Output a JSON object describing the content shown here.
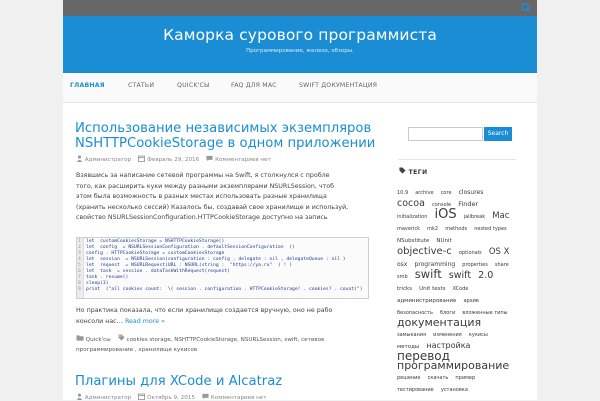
{
  "site": {
    "title": "Каморка сурового программиста",
    "description": "Программирование, железо, обзоры."
  },
  "nav": {
    "items": [
      {
        "label": "ГЛАВНАЯ",
        "active": true
      },
      {
        "label": "СТАТЬИ"
      },
      {
        "label": "QUICK'СЫ"
      },
      {
        "label": "FAQ ДЛЯ MAC"
      },
      {
        "label": "SWIFT ДОКУМЕНТАЦИЯ"
      }
    ]
  },
  "post1": {
    "title_line1": "Использование независимых экземпляров",
    "title_line2": "NSHTTPCookieStorage в одном приложении",
    "author": "Администратор",
    "date": "Февраль 29, 2016",
    "comments": "Комментариев нет",
    "excerpt": [
      "Взявшись за написание сетевой программы на Swift, я столкнулся с пробле",
      "того, как расширить куки между разными экземплярами NSURLSession, чтоб",
      "этом была возможность в разных местах использовать разные хранилища",
      "(хранить несколько сессий) Казалось бы, создавай свое хранилище и используй,",
      "свойство NSURLSessionConfiguration.HTTPCookieStorage доступно на запись"
    ],
    "code": [
      "let  customCookiesStorage = NSHTTPCookieStorage()",
      "let  config  = NSURLSessionConfiguration . defaultSessionConfiguration  ()",
      "config . HTTPCookieStorage = customCookiesStorage",
      "let  session  = NSURLSession(configuration : config , delegate : nil , delegateQueue : nil )",
      "let  request  = NSURLRequest(URL : NSURL(string :  \"https://ya.ru\"  ) ! )",
      "let  task  = session . dataTaskWithRequest(request)",
      "task . resume()",
      "sleep(3)",
      "print  (\"all cookies count:  \\( session . configuration . HTTPCookieStorage! . cookies? . count)\")"
    ],
    "after_code_1": "Но практика показала, что если хранилище создается вручную, оно не рабо",
    "after_code_2": "консоли нас…",
    "more": "Read more »",
    "category": "Quick'сы",
    "tags_1": "cookies storage, NSHTTPCookieStorage, NSURLSession, swift, сетевое",
    "tags_2": "программирование , хранилище кукисов"
  },
  "post2": {
    "title": "Плагины для XCode и Alcatraz",
    "author": "Администратор",
    "date": "Октябрь 9, 2015",
    "comments": "Комментариев нет"
  },
  "sidebar": {
    "search_placeholder": "",
    "search_button": "Search",
    "tags_title": "ТЕГИ",
    "tags": [
      {
        "t": "10.9",
        "s": 5
      },
      {
        "t": "archive",
        "s": 5
      },
      {
        "t": "core",
        "s": 5
      },
      {
        "t": "closures",
        "s": 6
      },
      {
        "t": "cocoa",
        "s": 9.5
      },
      {
        "t": "console",
        "s": 5
      },
      {
        "t": "Finder",
        "s": 6.5
      },
      {
        "t": "initialization",
        "s": 5
      },
      {
        "t": "iOS",
        "s": 13
      },
      {
        "t": "jailbreak",
        "s": 5
      },
      {
        "t": "Mac",
        "s": 8.5
      },
      {
        "t": "maverick",
        "s": 5
      },
      {
        "t": "mk2",
        "s": 5
      },
      {
        "t": "methods",
        "s": 5
      },
      {
        "t": "nested types",
        "s": 5
      },
      {
        "t": "NSubstitute",
        "s": 5.5
      },
      {
        "t": "NUnit",
        "s": 5.5
      },
      {
        "t": "objective-c",
        "s": 10
      },
      {
        "t": "optionals",
        "s": 5
      },
      {
        "t": "OS X",
        "s": 8.5
      },
      {
        "t": "osx",
        "s": 6
      },
      {
        "t": "programming",
        "s": 6
      },
      {
        "t": "properties",
        "s": 5
      },
      {
        "t": "share",
        "s": 5
      },
      {
        "t": "smb",
        "s": 5
      },
      {
        "t": "swift",
        "s": 11.5
      },
      {
        "t": "swift",
        "s": 9.5
      },
      {
        "t": "2.0",
        "s": 9.5
      },
      {
        "t": "tricks",
        "s": 5.5
      },
      {
        "t": "Unit tests",
        "s": 5.5
      },
      {
        "t": "XCode",
        "s": 5
      },
      {
        "t": "администрирование",
        "s": 5.5
      },
      {
        "t": "архив",
        "s": 5
      },
      {
        "t": "безопасность",
        "s": 5
      },
      {
        "t": "блоги",
        "s": 5
      },
      {
        "t": "вложенные типы",
        "s": 5
      },
      {
        "t": "документация",
        "s": 11
      },
      {
        "t": "замыкания",
        "s": 5
      },
      {
        "t": "изменения",
        "s": 5
      },
      {
        "t": "кукисы",
        "s": 5
      },
      {
        "t": "методы",
        "s": 5.5
      },
      {
        "t": "настройка",
        "s": 8
      },
      {
        "t": "перевод",
        "s": 12
      },
      {
        "t": "программирование",
        "s": 11
      },
      {
        "t": "решение",
        "s": 5
      },
      {
        "t": "скачать",
        "s": 5
      },
      {
        "t": "пример",
        "s": 5
      },
      {
        "t": "тестирование",
        "s": 5
      },
      {
        "t": "установка",
        "s": 5
      }
    ]
  },
  "colors": {
    "accent": "#1b8dd4",
    "topbar": "#676767"
  },
  "icons": {
    "search": "search-icon",
    "user": "user-icon",
    "calendar": "calendar-icon",
    "comment": "comment-icon",
    "folder": "folder-icon",
    "tag": "tag-icon",
    "tags_heading": "tags-icon"
  }
}
